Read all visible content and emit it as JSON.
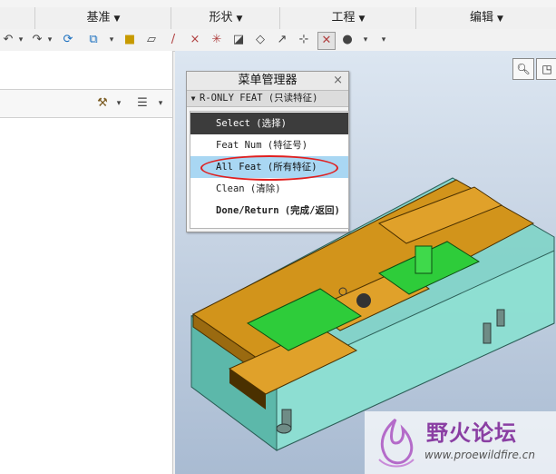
{
  "ribbon": {
    "groups": [
      {
        "label": "基准"
      },
      {
        "label": "形状"
      },
      {
        "label": "工程"
      },
      {
        "label": "编辑"
      }
    ]
  },
  "menu_manager": {
    "title": "菜单管理器",
    "close_glyph": "×",
    "submenu_title": "R-ONLY FEAT (只读特征)",
    "items": [
      {
        "label": "Select (选择)"
      },
      {
        "label": "Feat Num (特征号)"
      },
      {
        "label": "All Feat (所有特征)"
      },
      {
        "label": "Clean (清除)"
      },
      {
        "label": "Done/Return (完成/返回)"
      }
    ]
  },
  "watermark": {
    "brand": "野火论坛",
    "url": "www.proewildfire.cn"
  },
  "colors": {
    "mold_orange": "#d2941b",
    "cavity_green": "#2ecc3a",
    "base_teal": "#7ad4c6",
    "highlight_red": "#e02020",
    "hover_blue": "#a9d7f3"
  }
}
